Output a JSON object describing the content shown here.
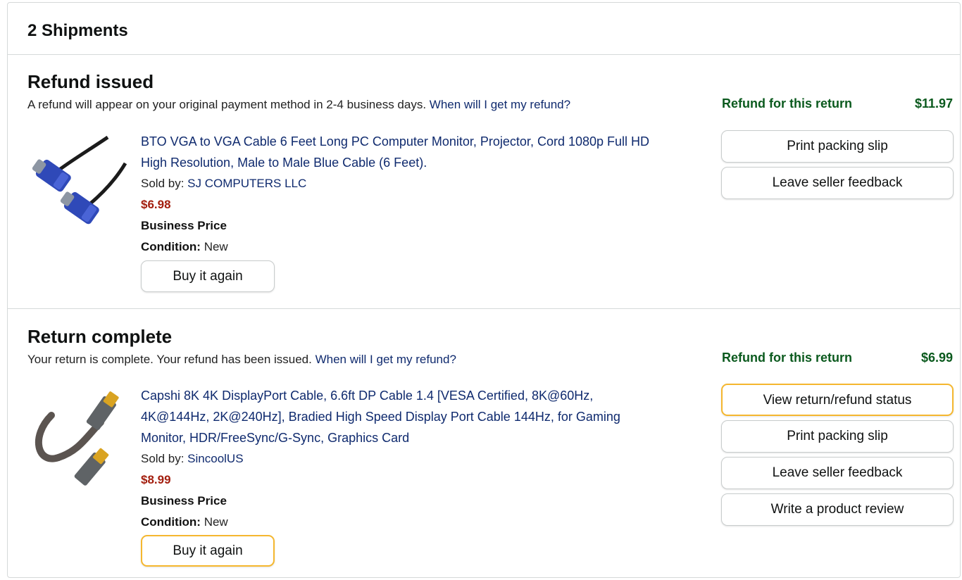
{
  "header": {
    "title": "2 Shipments"
  },
  "shipments": [
    {
      "status": "Refund issued",
      "message": "A refund will appear on your original payment method in 2-4 business days.",
      "link": "When will I get my refund?",
      "refund_label": "Refund for this return",
      "refund_amount": "$11.97",
      "product": {
        "title_line1": "BTO VGA to VGA Cable 6 Feet Long PC Computer Monitor, Projector, Cord 1080p Full HD",
        "title_line2": "High Resolution, Male to Male Blue Cable (6 Feet).",
        "sold_by_label": "Sold by:",
        "seller": "SJ COMPUTERS LLC",
        "price": "$6.98",
        "business_price": "Business Price",
        "condition_label": "Condition:",
        "condition": "New",
        "buy_again": "Buy it again",
        "image_icon": "vga-cable-image"
      },
      "actions": [
        "Print packing slip",
        "Leave seller feedback"
      ]
    },
    {
      "status": "Return complete",
      "message": "Your return is complete. Your refund has been issued.",
      "link": "When will I get my refund?",
      "refund_label": "Refund for this return",
      "refund_amount": "$6.99",
      "product": {
        "title_line1": "Capshi 8K 4K DisplayPort Cable, 6.6ft DP Cable 1.4 [VESA Certified, 8K@60Hz,",
        "title_line2": "4K@144Hz, 2K@240Hz], Bradied High Speed Display Port Cable 144Hz, for Gaming",
        "title_line3": "Monitor, HDR/FreeSync/G-Sync, Graphics Card",
        "sold_by_label": "Sold by:",
        "seller": "SincoolUS",
        "price": "$8.99",
        "business_price": "Business Price",
        "condition_label": "Condition:",
        "condition": "New",
        "buy_again": "Buy it again",
        "image_icon": "displayport-cable-image"
      },
      "actions": [
        "View return/refund status",
        "Print packing slip",
        "Leave seller feedback",
        "Write a product review"
      ]
    }
  ],
  "colors": {
    "link": "#0f2a6e",
    "price": "#a31e0e",
    "refund": "#0b5a1e",
    "highlight_border": "#f5b72f",
    "divider": "#d5d9d9"
  }
}
